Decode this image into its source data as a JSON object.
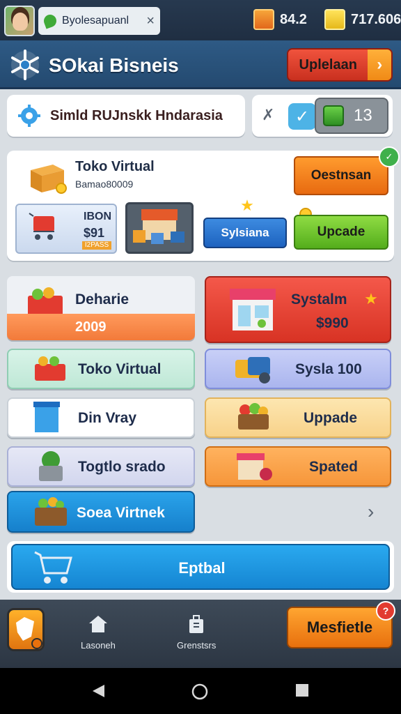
{
  "topbar": {
    "tab_label": "Byolesapuanl",
    "tab_close": "×",
    "resource_a": "84.2",
    "resource_b": "717.606"
  },
  "header": {
    "title": "SOkai Bisneis",
    "upgrade_label": "Uplelaan",
    "upgrade_arrow": "›"
  },
  "search": {
    "label": "Simld RUJnskk Hndarasia"
  },
  "tools": {
    "pin": "✗",
    "check": "✓",
    "gem_count": "13"
  },
  "shop": {
    "name": "Toko Virtual",
    "subtitle": "Bamao80009",
    "item_line1": "IBON",
    "item_line2": "$91",
    "item_badge": "I2PASS",
    "destination_label": "Oestnsan",
    "system_label": "Sylsiana",
    "update_label": "Upcade",
    "badge_icon": "✓",
    "star": "★"
  },
  "grid": {
    "behariel_label": "Deharie",
    "behariel_value": "2009",
    "system_label": "Systalm",
    "system_price": "$990",
    "system_star": "★",
    "toko_label": "Toko Virtual",
    "sysla_label": "Sysla 100",
    "dinvray_label": "Din Vray",
    "upgade_label": "Uppade",
    "togtlo_label": "Togtlo srado",
    "spated_label": "Spated",
    "soea_label": "Soea Virtnek",
    "chevron": "›"
  },
  "wide_button": {
    "label": "Eptbal"
  },
  "dock": {
    "nav1": "Lasoneh",
    "nav2": "Grenstsrs",
    "main_label": "Mesfietle",
    "notif": "?"
  },
  "colors": {
    "header_blue": "#2e5a85",
    "accent_orange": "#f08a16",
    "accent_red": "#e03a2a",
    "accent_green": "#54ad1c",
    "accent_blue": "#1d8fd9"
  }
}
